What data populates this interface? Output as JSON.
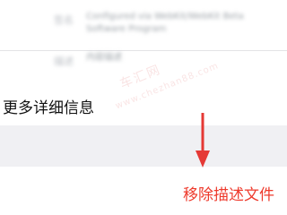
{
  "details": {
    "rows": [
      {
        "label": "签名",
        "value": "Configured via WebKit/WebKit Beta Software Program"
      },
      {
        "label": "描述",
        "value": "内容描述"
      }
    ]
  },
  "more_details": {
    "label": "更多详细信息"
  },
  "actions": {
    "remove_profile": "移除描述文件"
  },
  "watermark": {
    "cn": "车汇网",
    "en": "www.chezhan88.com"
  },
  "colors": {
    "destructive": "#ee3a2c",
    "annotation_arrow": "#e53935",
    "group_background": "#f0f0f3"
  }
}
